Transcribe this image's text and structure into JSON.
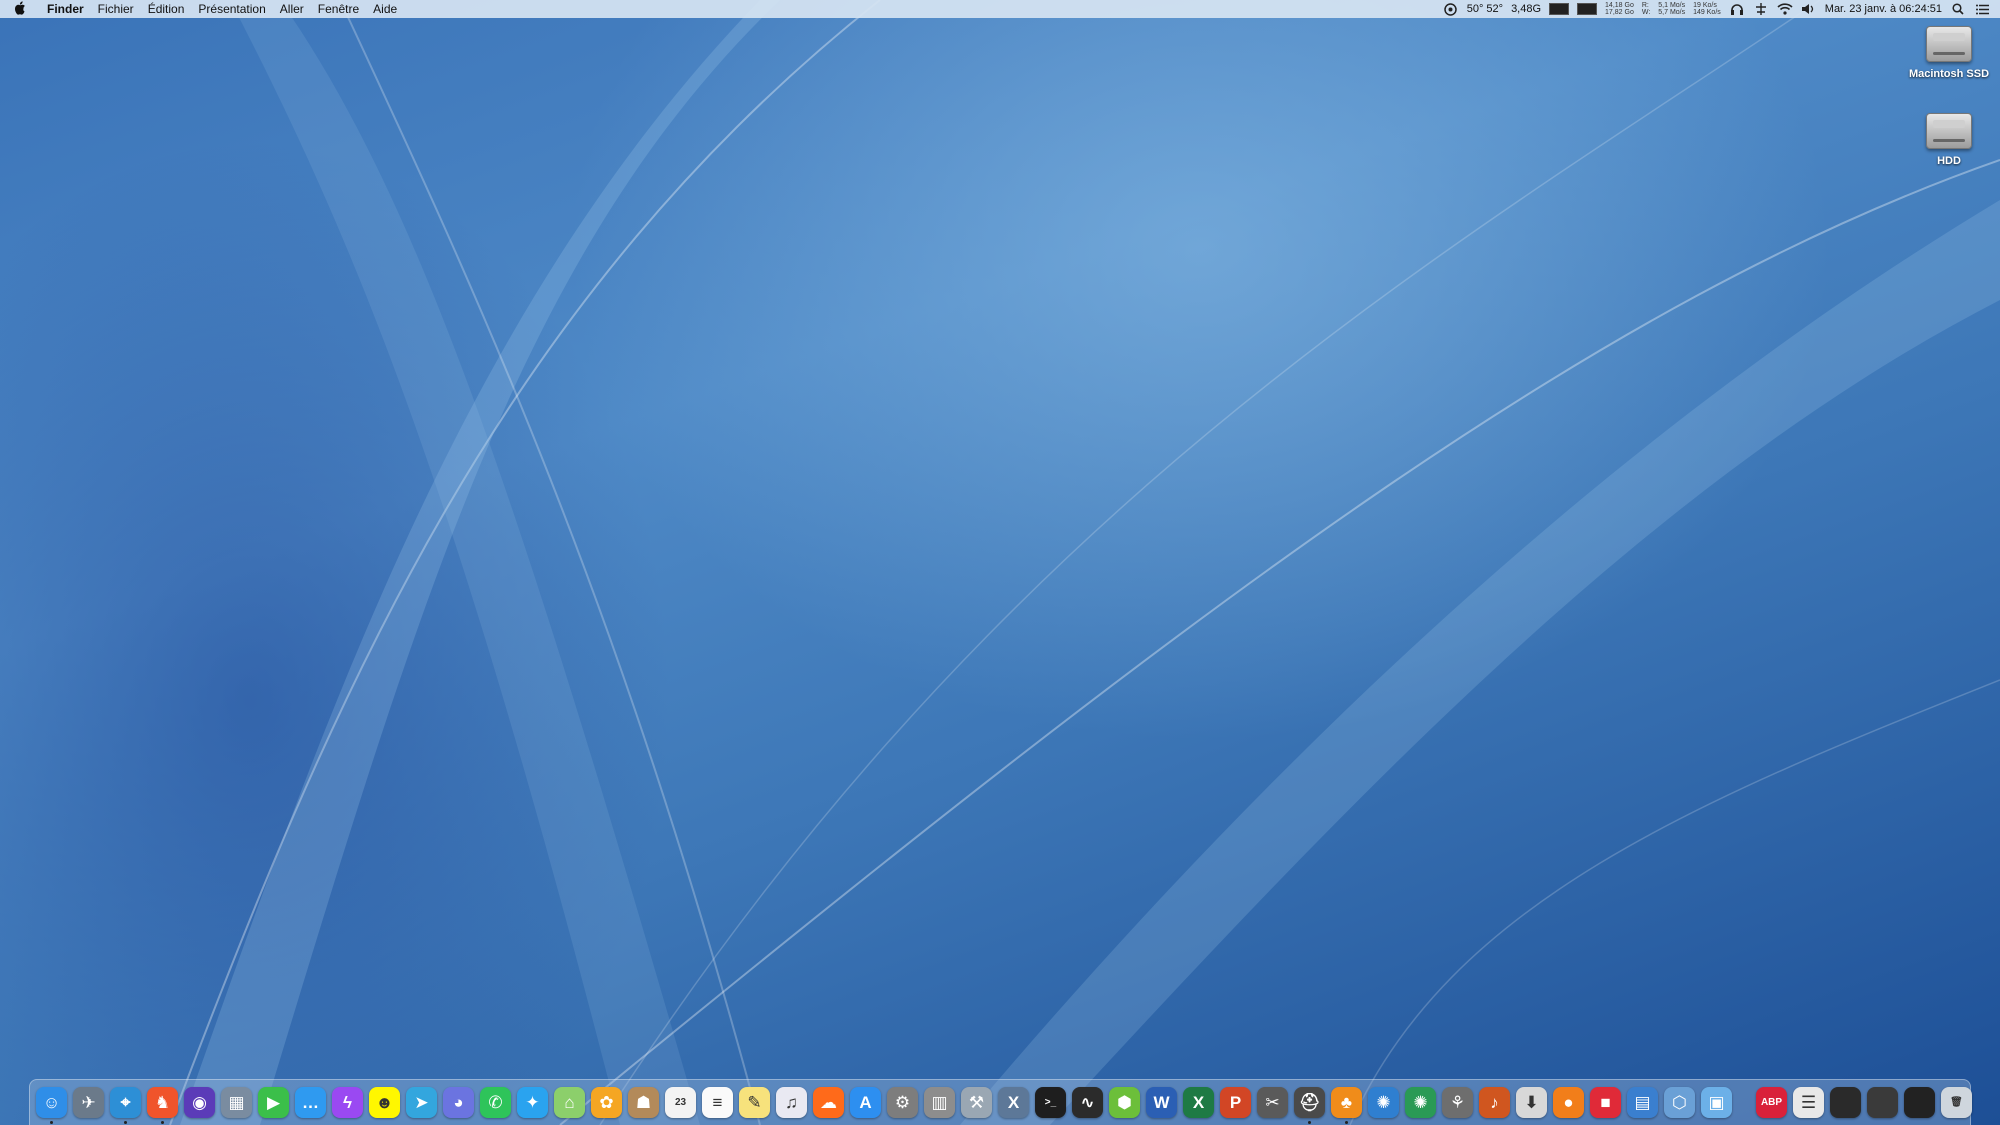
{
  "menubar": {
    "apple_icon": "apple-logo-icon",
    "items": [
      {
        "label": "Finder",
        "bold": true
      },
      {
        "label": "Fichier",
        "bold": false
      },
      {
        "label": "Édition",
        "bold": false
      },
      {
        "label": "Présentation",
        "bold": false
      },
      {
        "label": "Aller",
        "bold": false
      },
      {
        "label": "Fenêtre",
        "bold": false
      },
      {
        "label": "Aide",
        "bold": false
      }
    ],
    "status": {
      "temperature": "50° 52°",
      "ram": "3,48G",
      "disk_top": "14,18 Go",
      "disk_bottom": "17,82 Go",
      "disk_read": "R:",
      "disk_write": "W:",
      "net_up": "5,1 Mo/s",
      "net_down": "5,7 Mo/s",
      "net2_up": "19 Ko/s",
      "net2_down": "149 Ko/s",
      "clock": "Mar. 23 janv. à  06:24:51"
    }
  },
  "desktop": {
    "icons": [
      {
        "label": "Macintosh SSD",
        "icon": "hard-drive-icon"
      },
      {
        "label": "HDD",
        "icon": "hard-drive-icon"
      }
    ]
  },
  "dock": {
    "apps": [
      {
        "name": "finder",
        "glyph": "☺",
        "color": "#2f8ee8",
        "running": true
      },
      {
        "name": "launchpad",
        "glyph": "✈",
        "color": "#6b7a8a",
        "running": false
      },
      {
        "name": "safari",
        "glyph": "⌖",
        "color": "#2d8fd6",
        "running": true
      },
      {
        "name": "brave",
        "glyph": "♞",
        "color": "#f0542b",
        "running": true
      },
      {
        "name": "siri",
        "glyph": "◉",
        "color": "#5b3bb8",
        "running": false
      },
      {
        "name": "preview",
        "glyph": "▦",
        "color": "#7a8ca0",
        "running": false
      },
      {
        "name": "facetime",
        "glyph": "▶",
        "color": "#3bbf4a",
        "running": false
      },
      {
        "name": "messages",
        "glyph": "…",
        "color": "#2f9af0",
        "running": false
      },
      {
        "name": "messenger",
        "glyph": "ϟ",
        "color": "#9a49f2",
        "running": false
      },
      {
        "name": "snapchat",
        "glyph": "☻",
        "color": "#fff700",
        "running": false
      },
      {
        "name": "telegram",
        "glyph": "➤",
        "color": "#33a6de",
        "running": false
      },
      {
        "name": "discord",
        "glyph": "◕",
        "color": "#6b74e0",
        "running": false
      },
      {
        "name": "whatsapp",
        "glyph": "✆",
        "color": "#2ec45a",
        "running": false
      },
      {
        "name": "twitter",
        "glyph": "✦",
        "color": "#2aa3ef",
        "running": false
      },
      {
        "name": "maps",
        "glyph": "⌂",
        "color": "#8ccf6b",
        "running": false
      },
      {
        "name": "photos",
        "glyph": "✿",
        "color": "#f5a623",
        "running": false
      },
      {
        "name": "contacts",
        "glyph": "☗",
        "color": "#b38a5a",
        "running": false
      },
      {
        "name": "calendar",
        "glyph": "23",
        "color": "#f3f3f3",
        "running": false
      },
      {
        "name": "reminders",
        "glyph": "≡",
        "color": "#fafafa",
        "running": false
      },
      {
        "name": "notes",
        "glyph": "✎",
        "color": "#f7e27c",
        "running": false
      },
      {
        "name": "itunes",
        "glyph": "♫",
        "color": "#e9e9f2",
        "running": false
      },
      {
        "name": "soundcloud",
        "glyph": "☁",
        "color": "#ff6a1a",
        "running": false
      },
      {
        "name": "app-store",
        "glyph": "A",
        "color": "#2d8ff0",
        "running": false
      },
      {
        "name": "system-preferences",
        "glyph": "⚙",
        "color": "#7d7d7d",
        "running": false
      },
      {
        "name": "file-merge",
        "glyph": "▥",
        "color": "#8d8d8d",
        "running": false
      },
      {
        "name": "automator",
        "glyph": "⚒",
        "color": "#9aa7b3",
        "running": false
      },
      {
        "name": "xcode",
        "glyph": "X",
        "color": "#5d7898",
        "running": false
      },
      {
        "name": "terminal",
        "glyph": ">_",
        "color": "#1e1e1e",
        "running": false
      },
      {
        "name": "activity-monitor",
        "glyph": "∿",
        "color": "#2b2b2b",
        "running": false
      },
      {
        "name": "cube-app",
        "glyph": "⬢",
        "color": "#6cbf3a",
        "running": false
      },
      {
        "name": "word",
        "glyph": "W",
        "color": "#2b5fb4",
        "running": false
      },
      {
        "name": "excel",
        "glyph": "X",
        "color": "#1e7a44",
        "running": false
      },
      {
        "name": "powerpoint",
        "glyph": "P",
        "color": "#d24625",
        "running": false
      },
      {
        "name": "final-cut-pro",
        "glyph": "✂",
        "color": "#5a5a5a",
        "running": false
      },
      {
        "name": "disk-utility",
        "glyph": "⛑",
        "color": "#4a4a4a",
        "running": true
      },
      {
        "name": "fl-studio",
        "glyph": "♣",
        "color": "#f08c1a",
        "running": true
      },
      {
        "name": "audio-app",
        "glyph": "✺",
        "color": "#2f7fd0",
        "running": false
      },
      {
        "name": "audio-app-2",
        "glyph": "✺",
        "color": "#2a9a55",
        "running": false
      },
      {
        "name": "gimp",
        "glyph": "⚘",
        "color": "#6e6e6e",
        "running": false
      },
      {
        "name": "headphones",
        "glyph": "♪",
        "color": "#d0561f",
        "running": false
      },
      {
        "name": "downloader",
        "glyph": "⬇",
        "color": "#d8d8d8",
        "running": false
      },
      {
        "name": "vlc-like",
        "glyph": "●",
        "color": "#f27e1a",
        "running": false
      },
      {
        "name": "red-app",
        "glyph": "■",
        "color": "#e02a38",
        "running": false
      },
      {
        "name": "virtualization",
        "glyph": "▤",
        "color": "#3a7fcf",
        "running": false
      },
      {
        "name": "virtualbox",
        "glyph": "⬡",
        "color": "#6aa0d6",
        "running": false
      },
      {
        "name": "screen-app",
        "glyph": "▣",
        "color": "#6cb0e8",
        "running": false
      }
    ],
    "others": [
      {
        "name": "adblock",
        "glyph": "ABP",
        "color": "#d9213a"
      },
      {
        "name": "folder-stack",
        "glyph": "☰",
        "color": "#e8e8e8"
      },
      {
        "name": "minimized-window-1",
        "glyph": "",
        "color": "#2a2a2a"
      },
      {
        "name": "minimized-window-2",
        "glyph": "",
        "color": "#3a3a3a"
      },
      {
        "name": "minimized-window-3",
        "glyph": "",
        "color": "#222222"
      },
      {
        "name": "trash",
        "glyph": "🗑",
        "color": "#cfd6dd"
      }
    ]
  },
  "colors": {
    "menubar_bg": "#d6e4f2",
    "wallpaper_accent": "#4f8ac7"
  }
}
